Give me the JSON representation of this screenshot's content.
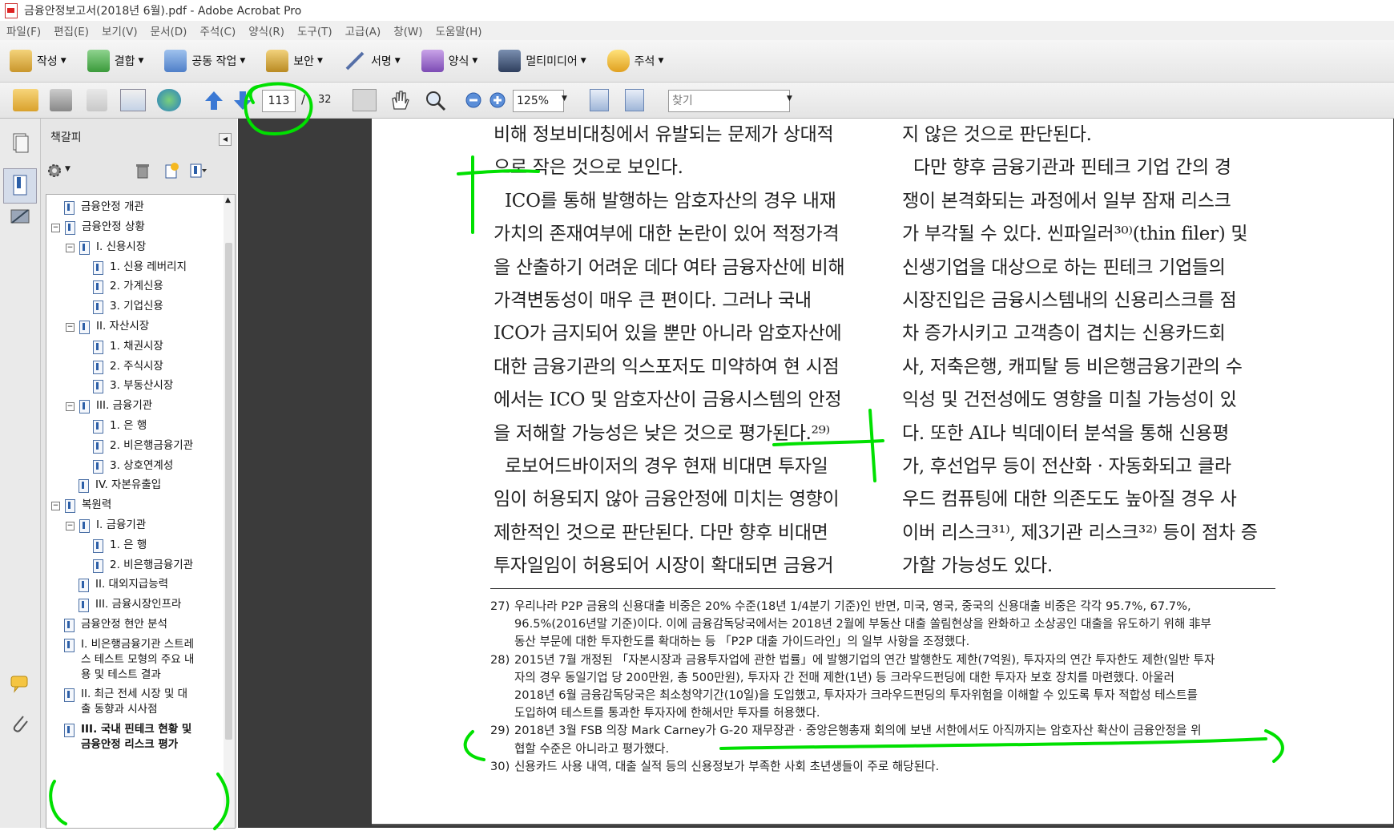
{
  "window": {
    "title": "금융안정보고서(2018년 6월).pdf - Adobe Acrobat Pro"
  },
  "menu": [
    "파일(F)",
    "편집(E)",
    "보기(V)",
    "문서(D)",
    "주석(C)",
    "양식(R)",
    "도구(T)",
    "고급(A)",
    "창(W)",
    "도움말(H)"
  ],
  "toolbar": {
    "create": "작성",
    "combine": "결합",
    "collaborate": "공동 작업",
    "secure": "보안",
    "sign": "서명",
    "forms": "양식",
    "multimedia": "멀티미디어",
    "comment": "주석"
  },
  "nav": {
    "page_current": "113",
    "page_sep": "/",
    "page_total": "32",
    "zoom": "125%",
    "find_placeholder": "찾기"
  },
  "bookmarks": {
    "title": "책갈피",
    "items": [
      "금융안정 개관",
      "금융안정 상황",
      "I. 신용시장",
      "1. 신용 레버리지",
      "2. 가계신용",
      "3. 기업신용",
      "II. 자산시장",
      "1. 채권시장",
      "2. 주식시장",
      "3. 부동산시장",
      "III. 금융기관",
      "1. 은 행",
      "2. 비은행금융기관",
      "3. 상호연계성",
      "IV. 자본유출입",
      "복원력",
      "I. 금융기관",
      "1. 은 행",
      "2. 비은행금융기관",
      "II. 대외지급능력",
      "III. 금융시장인프라",
      "금융안정 현안 분석",
      "I. 비은행금융기관 스트레\n스 테스트 모형의 주요 내\n용 및 테스트 결과",
      "II. 최근 전세 시장 및 대\n출 동향과 시사점",
      "III. 국내 핀테크 현황 및\n금융안정 리스크 평가"
    ]
  },
  "document": {
    "left_column": [
      "비해 정보비대칭에서 유발되는 문제가 상대적",
      "으로 작은 것으로 보인다.",
      "  ICO를 통해 발행하는 암호자산의 경우 내재",
      "가치의 존재여부에 대한 논란이 있어 적정가격",
      "을 산출하기 어려운 데다 여타 금융자산에 비해",
      "가격변동성이 매우 큰 편이다. 그러나 국내",
      "ICO가 금지되어 있을 뿐만 아니라 암호자산에",
      "대한 금융기관의 익스포저도 미약하여 현 시점",
      "에서는 ICO 및 암호자산이 금융시스템의 안정",
      "을 저해할 가능성은 낮은 것으로 평가된다.²⁹⁾",
      "  로보어드바이저의 경우 현재 비대면 투자일",
      "임이 허용되지 않아 금융안정에 미치는 영향이",
      "제한적인 것으로 판단된다. 다만 향후 비대면",
      "투자일임이 허용되어 시장이 확대되면 금융거"
    ],
    "right_column": [
      "지 않은 것으로 판단된다.",
      "  다만 향후 금융기관과 핀테크 기업 간의 경",
      "쟁이 본격화되는 과정에서 일부 잠재 리스크",
      "가 부각될 수 있다. 씬파일러³⁰⁾(thin filer) 및",
      "신생기업을 대상으로 하는 핀테크 기업들의",
      "시장진입은 금융시스템내의 신용리스크를 점",
      "차 증가시키고 고객층이 겹치는 신용카드회",
      "사, 저축은행, 캐피탈 등 비은행금융기관의 수",
      "익성 및 건전성에도 영향을 미칠 가능성이 있",
      "다. 또한 AI나 빅데이터 분석을 통해 신용평",
      "가, 후선업무 등이 전산화 · 자동화되고 클라",
      "우드 컴퓨팅에 대한 의존도도 높아질 경우 사",
      "이버 리스크³¹⁾, 제3기관 리스크³²⁾ 등이 점차 증",
      "가할 가능성도 있다."
    ],
    "footnotes": [
      {
        "num": "27)",
        "lines": [
          "우리나라 P2P 금융의 신용대출 비중은 20% 수준(18년 1/4분기 기준)인 반면, 미국, 영국, 중국의 신용대출 비중은 각각 95.7%, 67.7%,",
          "96.5%(2016년말 기준)이다. 이에 금융감독당국에서는 2018년 2월에 부동산 대출 쏠림현상을 완화하고 소상공인 대출을 유도하기 위해 非부",
          "동산 부문에 대한 투자한도를 확대하는 등 「P2P 대출 가이드라인」의 일부 사항을 조정했다."
        ]
      },
      {
        "num": "28)",
        "lines": [
          "2015년 7월 개정된 「자본시장과 금융투자업에 관한 법률」에 발행기업의 연간 발행한도 제한(7억원), 투자자의 연간 투자한도 제한(일반 투자",
          "자의 경우 동일기업 당 200만원, 총 500만원), 투자자 간 전매 제한(1년) 등 크라우드펀딩에 대한 투자자 보호 장치를 마련했다. 아울러",
          "2018년 6월 금융감독당국은 최소청약기간(10일)을 도입했고, 투자자가 크라우드펀딩의 투자위험을 이해할 수 있도록 투자 적합성 테스트를",
          "도입하여 테스트를 통과한 투자자에 한해서만 투자를 허용했다."
        ]
      },
      {
        "num": "29)",
        "lines": [
          "2018년 3월 FSB 의장 Mark Carney가 G-20 재무장관 · 중앙은행총재 회의에 보낸 서한에서도 아직까지는 암호자산 확산이 금융안정을 위",
          "협할 수준은 아니라고 평가했다."
        ]
      },
      {
        "num": "30)",
        "lines": [
          "신용카드 사용 내역, 대출 실적 등의 신용정보가 부족한 사회 초년생들이 주로 해당된다."
        ]
      }
    ]
  },
  "colors": {
    "annotation": "#00e000",
    "doc_background": "#3b3b3b",
    "ink": "#222222"
  }
}
